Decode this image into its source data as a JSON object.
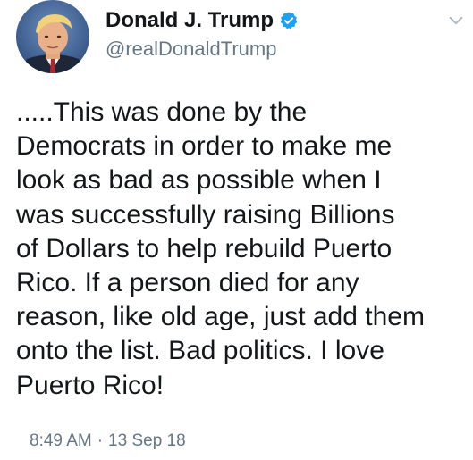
{
  "author": {
    "display_name": "Donald J. Trump",
    "handle": "@realDonaldTrump",
    "verified": true,
    "avatar_icon": "profile-photo",
    "verified_icon": "verified-badge-icon"
  },
  "menu": {
    "icon": "chevron-down-icon"
  },
  "tweet": {
    "lines": [
      ".....This was done by the",
      "Democrats in order to make me",
      "look as bad as possible when I",
      "was successfully raising Billions",
      "of Dollars to help rebuild Puerto",
      "Rico. If a person died for any",
      "reason, like old age, just add them",
      "onto the list. Bad politics. I love",
      "Puerto Rico!"
    ]
  },
  "meta": {
    "time": "8:49 AM",
    "separator": "·",
    "date": "13 Sep 18"
  },
  "colors": {
    "text_primary": "#14171a",
    "text_secondary": "#657786",
    "verified_blue": "#1da1f2",
    "caret_gray": "#aab8c2"
  }
}
